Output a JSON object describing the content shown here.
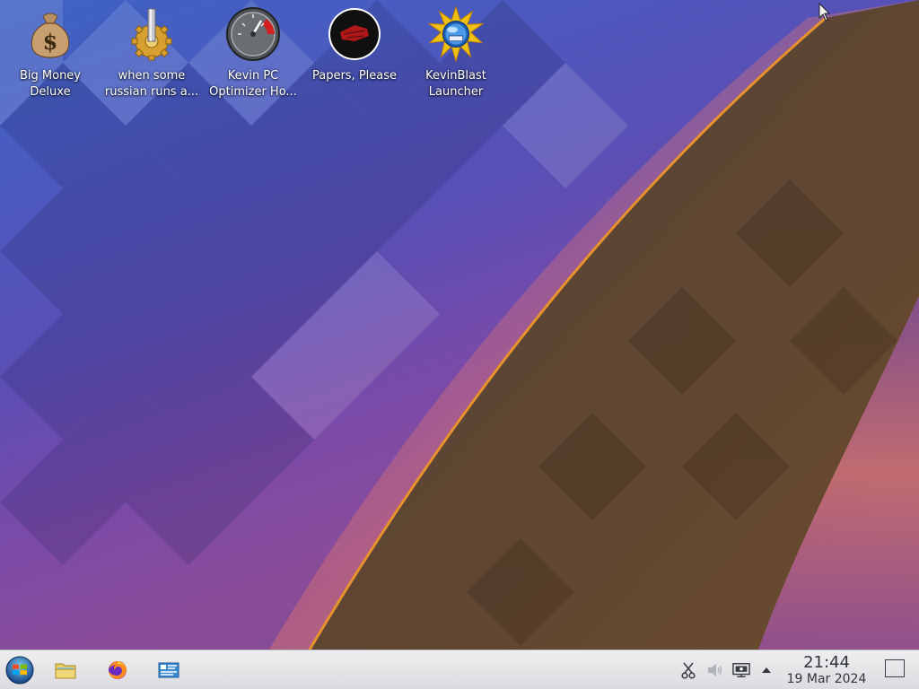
{
  "desktop": {
    "icons": [
      {
        "label": "Big Money\nDeluxe",
        "icon": "money-bag-icon"
      },
      {
        "label": "when some\nrussian runs a...",
        "icon": "gear-icon"
      },
      {
        "label": "Kevin PC\nOptimizer Ho...",
        "icon": "speedometer-icon"
      },
      {
        "label": "Papers, Please",
        "icon": "papers-please-emblem-icon"
      },
      {
        "label": "KevinBlast\nLauncher",
        "icon": "starburst-globe-icon"
      }
    ]
  },
  "taskbar": {
    "start_icon": "windows-start-icon",
    "pinned": [
      {
        "name": "file-manager",
        "icon": "folder-icon"
      },
      {
        "name": "firefox",
        "icon": "firefox-icon"
      },
      {
        "name": "system-settings",
        "icon": "settings-panel-icon"
      }
    ],
    "tray": [
      {
        "name": "clipboard",
        "icon": "scissors-icon"
      },
      {
        "name": "volume",
        "icon": "speaker-icon"
      },
      {
        "name": "display",
        "icon": "monitor-icon"
      },
      {
        "name": "expand-tray",
        "icon": "caret-up-icon"
      }
    ],
    "clock": {
      "time": "21:44",
      "date": "19 Mar 2024"
    },
    "show_desktop_icon": "show-desktop-icon"
  },
  "colors": {
    "taskbar_bg": "#e4e4e8",
    "text_dark": "#31363b",
    "wallpaper_blue": "#3d63c4",
    "wallpaper_purple": "#7a4aa8",
    "wallpaper_brown": "#5e4632",
    "accent_orange": "#e08a2c"
  }
}
